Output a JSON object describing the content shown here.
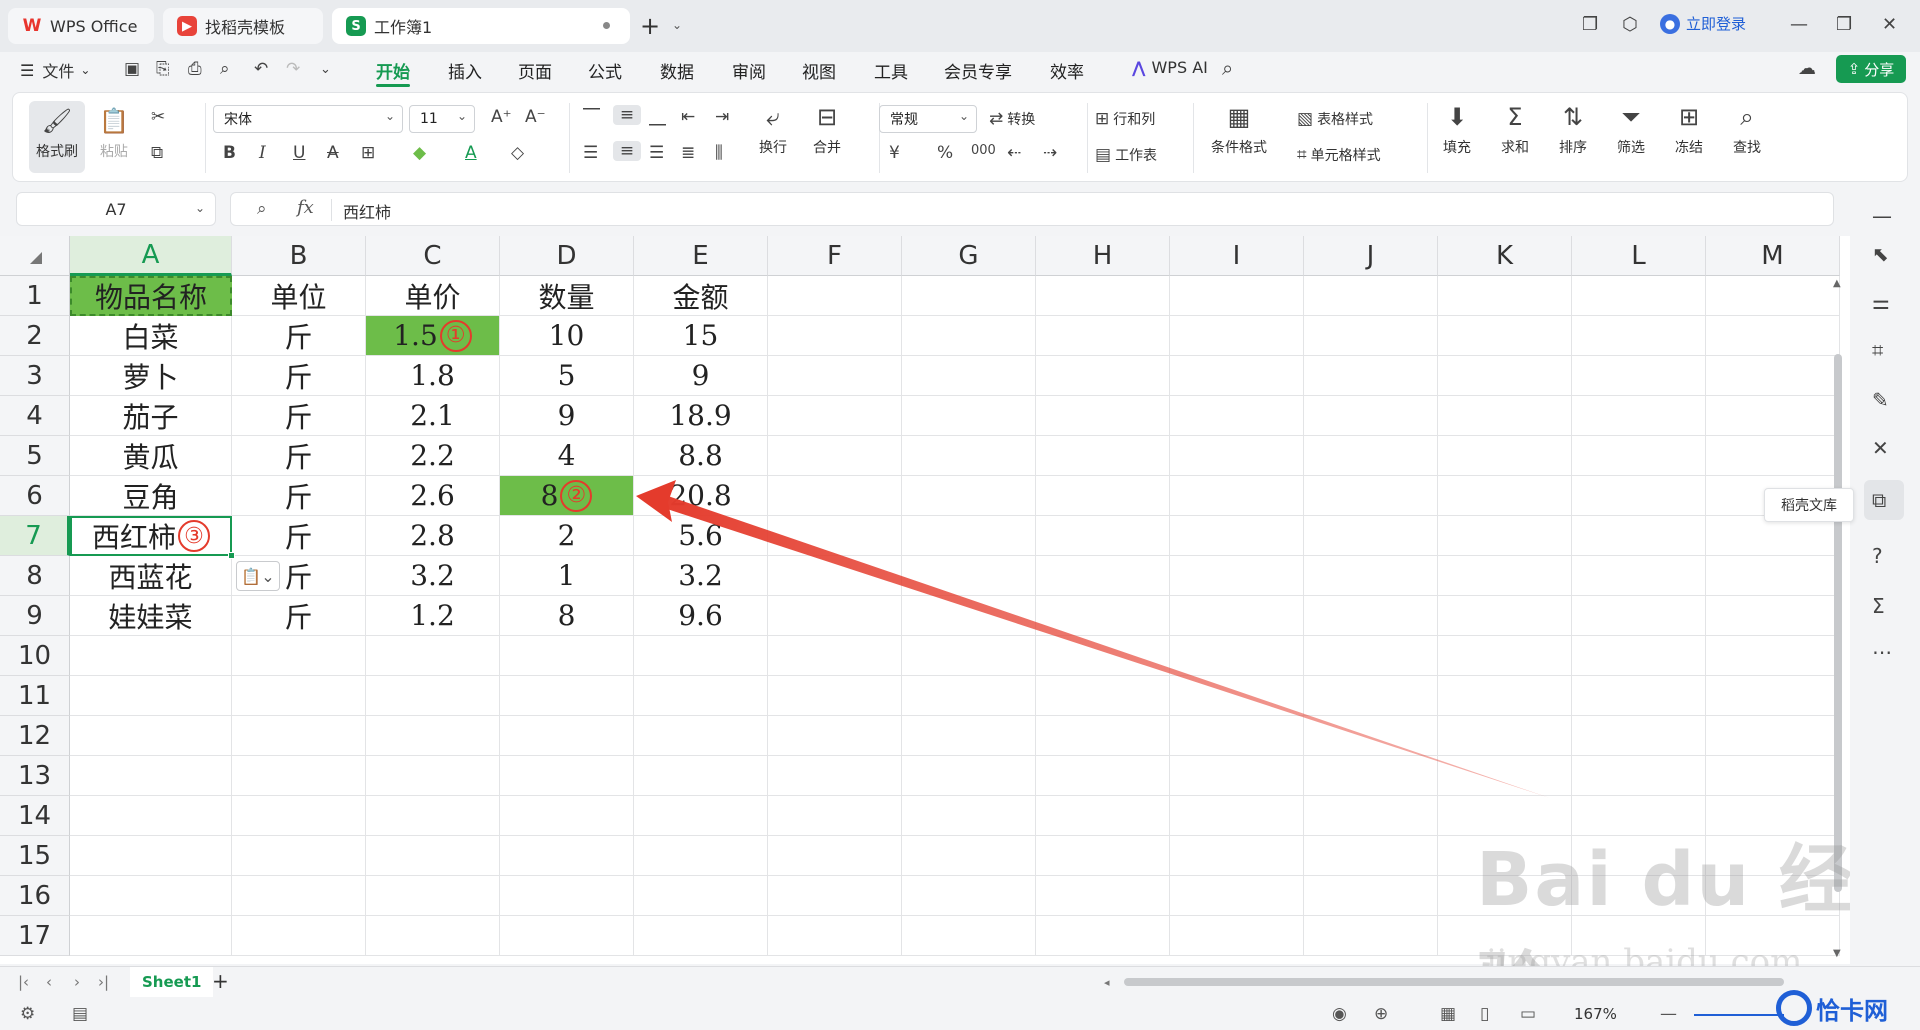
{
  "tabs": [
    {
      "label": "WPS Office",
      "icon": "wps-logo-icon"
    },
    {
      "label": "找稻壳模板",
      "icon": "template-icon"
    },
    {
      "label": "工作簿1",
      "icon": "spreadsheet-icon"
    }
  ],
  "header": {
    "login_label": "立即登录",
    "share_label": "分享"
  },
  "menu": {
    "file_label": "文件",
    "items": [
      "开始",
      "插入",
      "页面",
      "公式",
      "数据",
      "审阅",
      "视图",
      "工具",
      "会员专享",
      "效率"
    ],
    "active": "开始",
    "ai_label": "WPS AI"
  },
  "ribbon": {
    "format_painter": "格式刷",
    "paste": "粘贴",
    "font_name": "宋体",
    "font_size": "11",
    "wrap": "换行",
    "merge": "合并",
    "number_format": "常规",
    "convert": "转换",
    "rows_cols": "行和列",
    "worksheet": "工作表",
    "cond_format": "条件格式",
    "table_style": "表格样式",
    "cell_style": "单元格样式",
    "fill": "填充",
    "sum": "求和",
    "sort": "排序",
    "filter": "筛选",
    "freeze": "冻结",
    "find": "查找",
    "bold": "B",
    "italic": "I",
    "underline": "U",
    "strike": "A",
    "font_color": "A",
    "currency": "¥",
    "percent": "%",
    "thousands": "000"
  },
  "formula_bar": {
    "cell_ref": "A7",
    "fx": "fx",
    "value": "西红柿"
  },
  "grid": {
    "columns": [
      "A",
      "B",
      "C",
      "D",
      "E",
      "F",
      "G",
      "H",
      "I",
      "J",
      "K",
      "L",
      "M"
    ],
    "rows": [
      "1",
      "2",
      "3",
      "4",
      "5",
      "6",
      "7",
      "8",
      "9",
      "10",
      "11",
      "12",
      "13",
      "14",
      "15",
      "16",
      "17"
    ],
    "header_row": [
      "物品名称",
      "单位",
      "单价",
      "数量",
      "金额"
    ],
    "data": [
      [
        "白菜",
        "斤",
        "1.5",
        "10",
        "15"
      ],
      [
        "萝卜",
        "斤",
        "1.8",
        "5",
        "9"
      ],
      [
        "茄子",
        "斤",
        "2.1",
        "9",
        "18.9"
      ],
      [
        "黄瓜",
        "斤",
        "2.2",
        "4",
        "8.8"
      ],
      [
        "豆角",
        "斤",
        "2.6",
        "8",
        "20.8"
      ],
      [
        "西红柿",
        "斤",
        "2.8",
        "2",
        "5.6"
      ],
      [
        "西蓝花",
        "斤",
        "3.2",
        "1",
        "3.2"
      ],
      [
        "娃娃菜",
        "斤",
        "1.2",
        "8",
        "9.6"
      ]
    ],
    "markers": {
      "c2": "①",
      "d6": "②",
      "a7": "③"
    },
    "highlight_color": "#6dbd49",
    "marker_color": "#e43b2c"
  },
  "sidebar": {
    "tooltip": "稻壳文库"
  },
  "sheets": {
    "active": "Sheet1"
  },
  "status": {
    "zoom": "167%"
  },
  "watermark": {
    "main": "Bai du 经验",
    "sub": "jingyan.baidu.com",
    "brand": "恰卡网"
  }
}
